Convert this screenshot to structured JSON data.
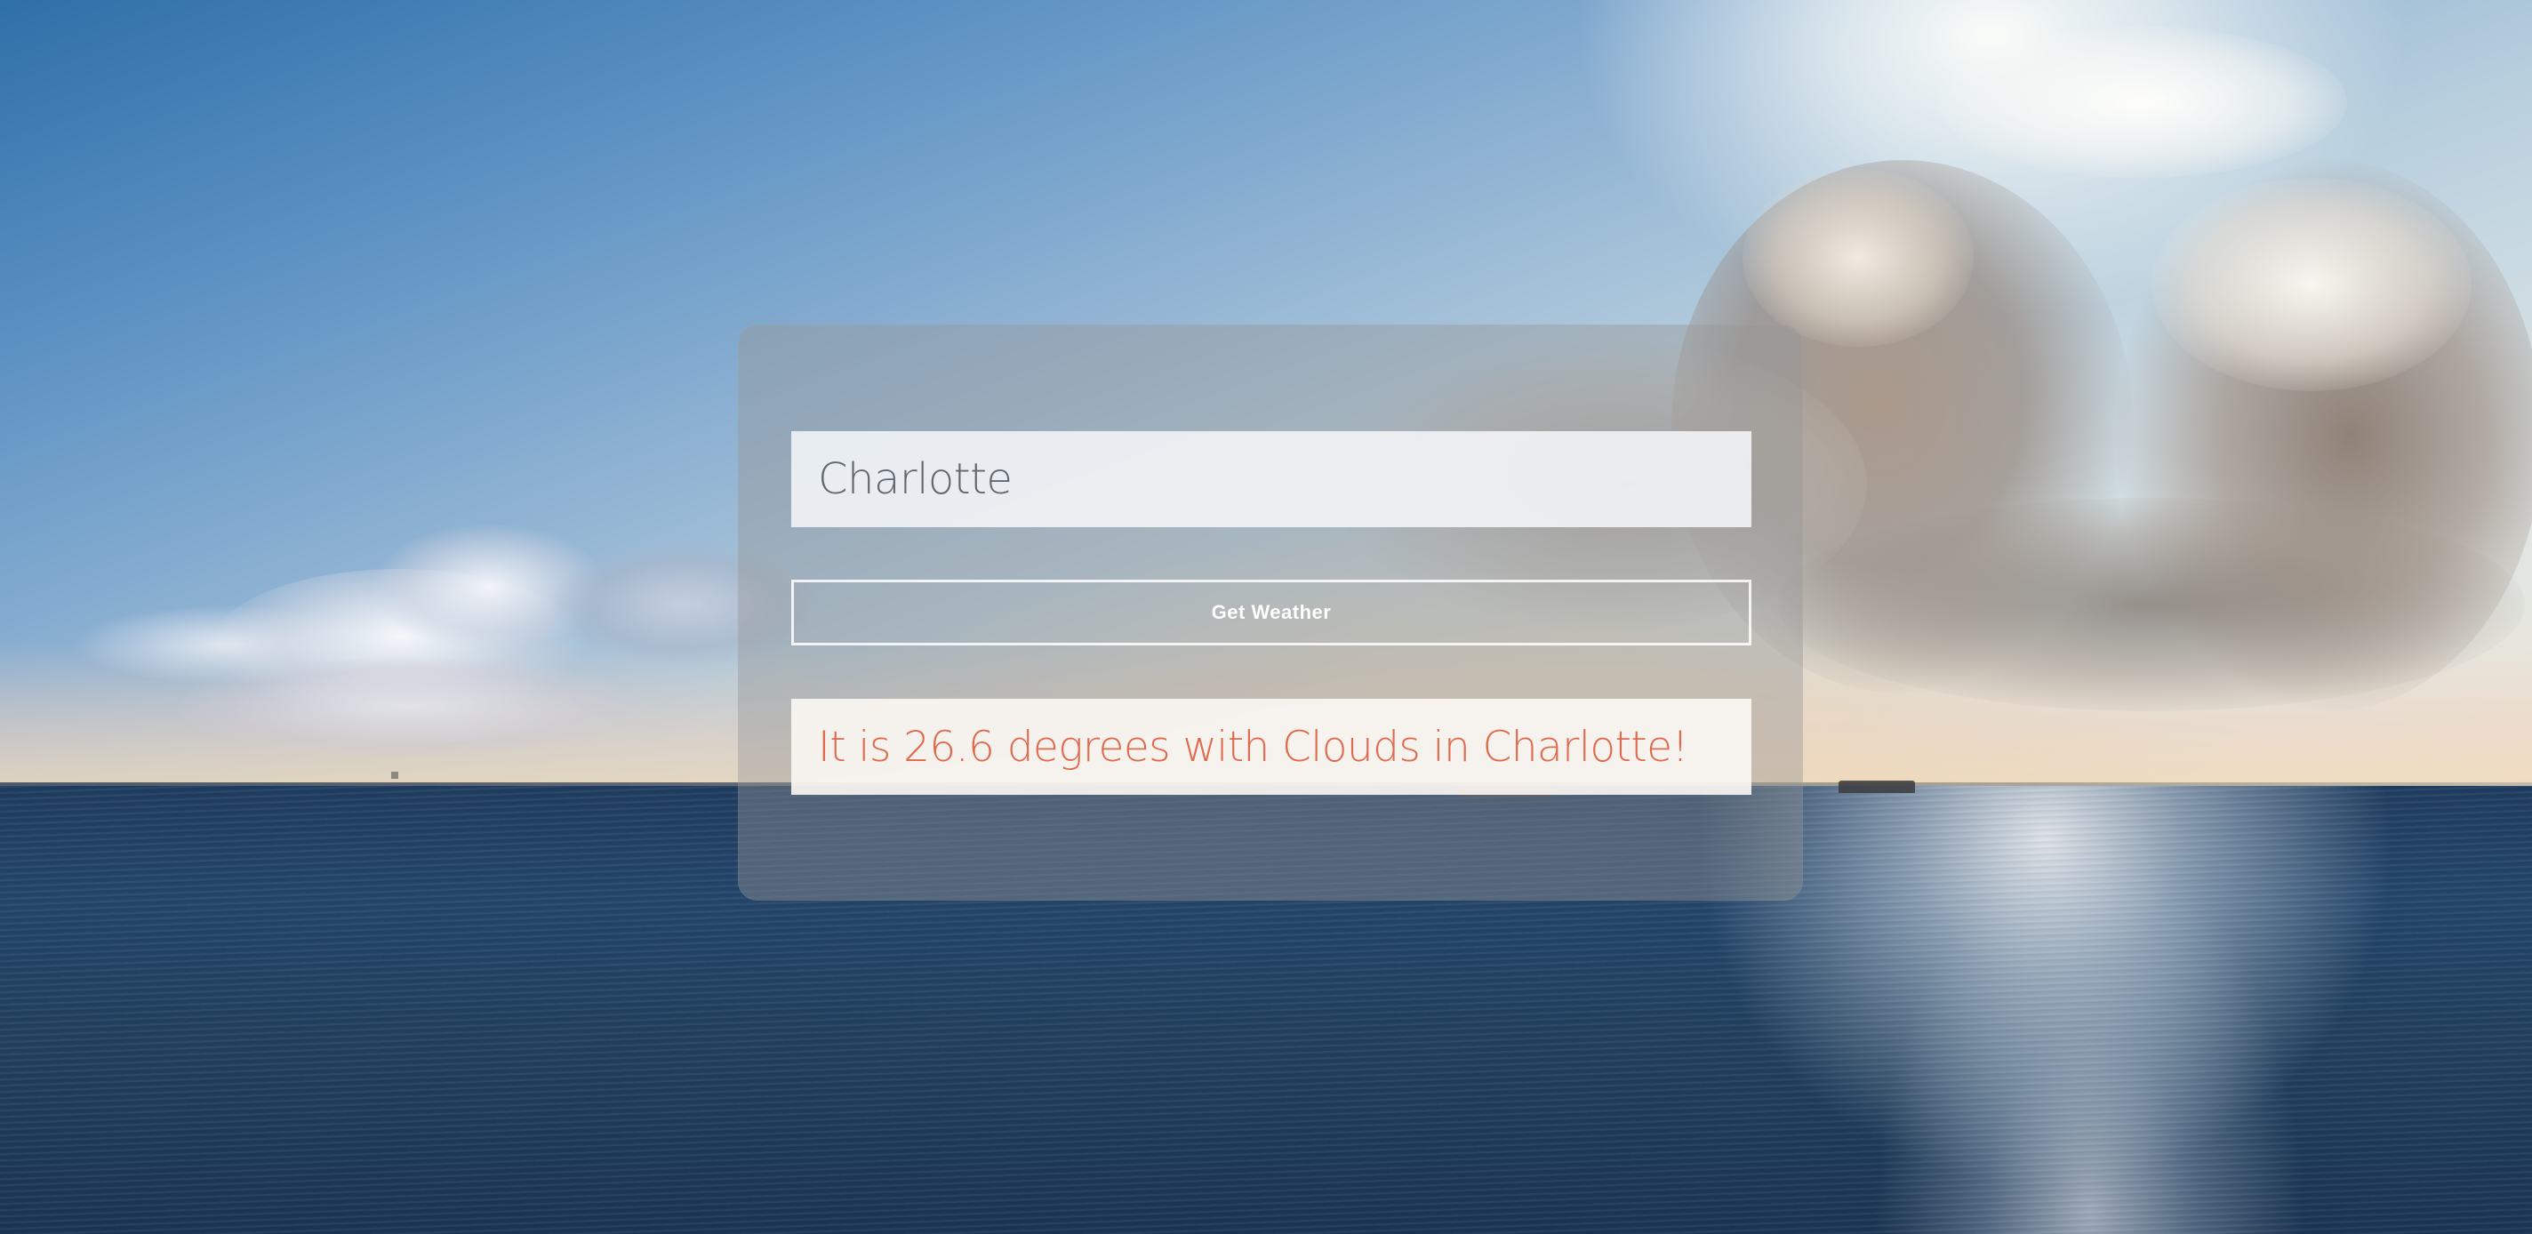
{
  "search": {
    "value": "Charlotte",
    "placeholder": ""
  },
  "actions": {
    "get_weather_label": "Get Weather"
  },
  "result": {
    "message": "It is 26.6 degrees with Clouds in Charlotte!"
  },
  "colors": {
    "result_text": "#e06a4e",
    "input_text": "#626870",
    "button_text": "#ffffff"
  }
}
